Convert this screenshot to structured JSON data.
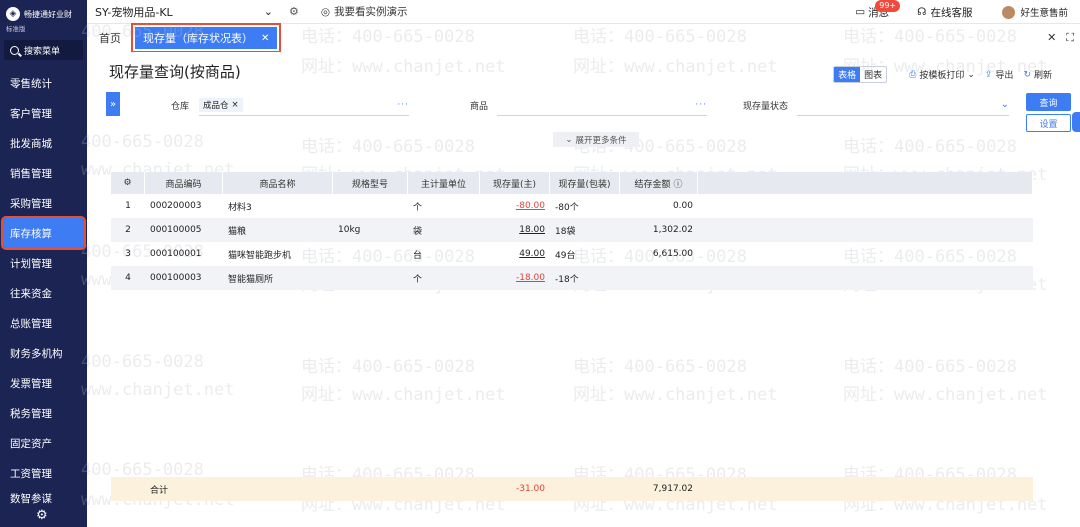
{
  "sidebar": {
    "brand": "畅捷通好业财",
    "edition": "标准版",
    "search_label": "搜索菜单",
    "items": [
      {
        "label": "零售统计"
      },
      {
        "label": "客户管理"
      },
      {
        "label": "批发商城"
      },
      {
        "label": "销售管理"
      },
      {
        "label": "采购管理"
      },
      {
        "label": "库存核算"
      },
      {
        "label": "计划管理"
      },
      {
        "label": "往来资金"
      },
      {
        "label": "总账管理"
      },
      {
        "label": "财务多机构"
      },
      {
        "label": "发票管理"
      },
      {
        "label": "税务管理"
      },
      {
        "label": "固定资产"
      },
      {
        "label": "工资管理"
      },
      {
        "label": "数智参谋"
      }
    ],
    "active_index": 5
  },
  "topbar": {
    "company": "SY-宠物用品-KL",
    "demo_link": "我要看实例演示",
    "messages_label": "消息",
    "messages_badge": "99+",
    "support_label": "在线客服",
    "user_name": "好生意售前"
  },
  "tabs": {
    "home": "首页",
    "active": "现存量（库存状况表）"
  },
  "page": {
    "title": "现存量查询(按商品)",
    "view_table": "表格",
    "view_chart": "图表",
    "print_label": "按模板打印",
    "export_label": "导出",
    "refresh_label": "刷新"
  },
  "filters": {
    "warehouse_label": "仓库",
    "warehouse_value": "成品仓",
    "product_label": "商品",
    "product_value": "",
    "status_label": "现存量状态",
    "status_value": "",
    "query_button": "查询",
    "settings_button": "设置",
    "more_conditions": "展开更多条件"
  },
  "table": {
    "headers": [
      "商品编码",
      "商品名称",
      "规格型号",
      "主计量单位",
      "现存量(主)",
      "现存量(包装)",
      "结存金额"
    ],
    "rows": [
      {
        "no": "1",
        "code": "000200003",
        "name": "材料3",
        "spec": "",
        "unit": "个",
        "qty": "-80.00",
        "pack": "-80个",
        "amount": "0.00"
      },
      {
        "no": "2",
        "code": "000100005",
        "name": "猫粮",
        "spec": "10kg",
        "unit": "袋",
        "qty": "18.00",
        "pack": "18袋",
        "amount": "1,302.02"
      },
      {
        "no": "3",
        "code": "000100001",
        "name": "猫咪智能跑步机",
        "spec": "",
        "unit": "台",
        "qty": "49.00",
        "pack": "49台",
        "amount": "6,615.00"
      },
      {
        "no": "4",
        "code": "000100003",
        "name": "智能猫厕所",
        "spec": "",
        "unit": "个",
        "qty": "-18.00",
        "pack": "-18个",
        "amount": ""
      }
    ],
    "total_label": "合计",
    "total_qty": "-31.00",
    "total_amount": "7,917.02"
  },
  "watermark": {
    "phone": "电话：400-665-0028",
    "phone_short": "400-665-0028",
    "site": "网址：www.chanjet.net",
    "site_short": "www.chanjet.net"
  }
}
